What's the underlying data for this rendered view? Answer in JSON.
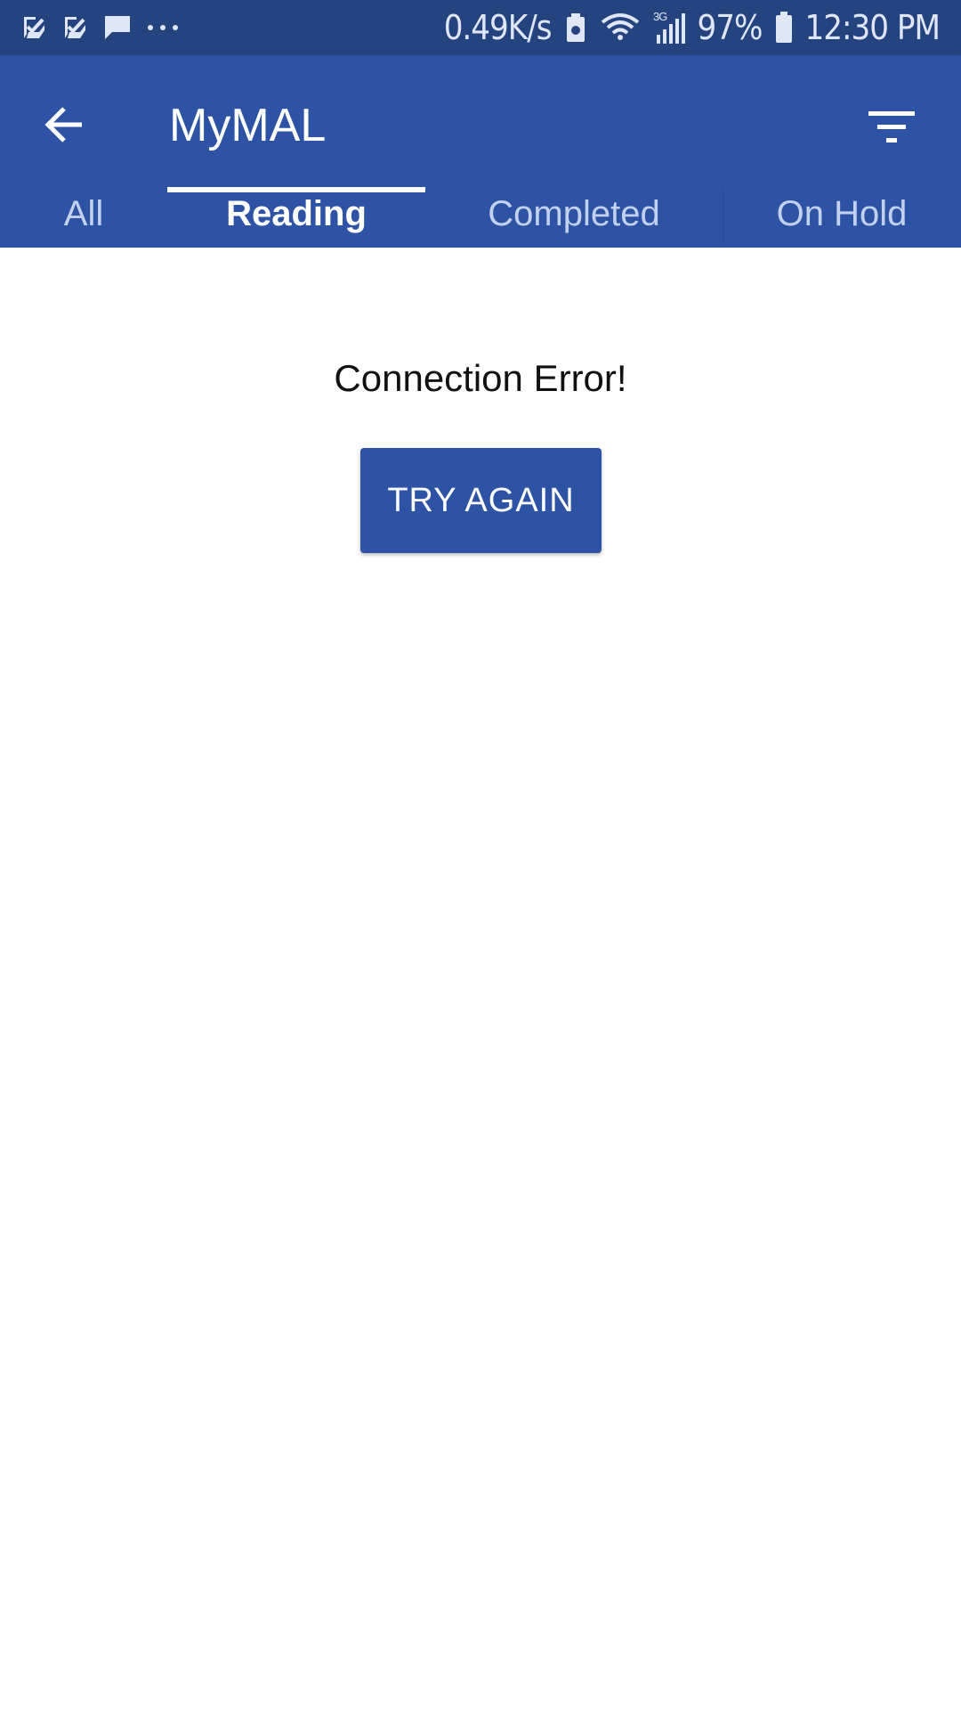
{
  "status_bar": {
    "notification_icons": [
      "check-task-icon",
      "check-task-icon",
      "chat-bubble-icon",
      "more-dots-icon"
    ],
    "net_speed": "0.49K/s",
    "network_type": "3G",
    "battery_percent": "97%",
    "time": "12:30 PM"
  },
  "app_bar": {
    "title": "MyMAL",
    "back_icon": "arrow-back-icon",
    "filter_icon": "filter-icon"
  },
  "tabs": [
    {
      "label": "All",
      "selected": false
    },
    {
      "label": "Reading",
      "selected": true
    },
    {
      "label": "Completed",
      "selected": false
    },
    {
      "label": "On Hold",
      "selected": false
    }
  ],
  "content": {
    "error_message": "Connection Error!",
    "retry_button_label": "TRY AGAIN"
  },
  "colors": {
    "status_bar": "#25437f",
    "primary": "#2f53a4",
    "tab_inactive_text": "#c3d1ef",
    "tab_active_text": "#ffffff",
    "background": "#ffffff"
  }
}
